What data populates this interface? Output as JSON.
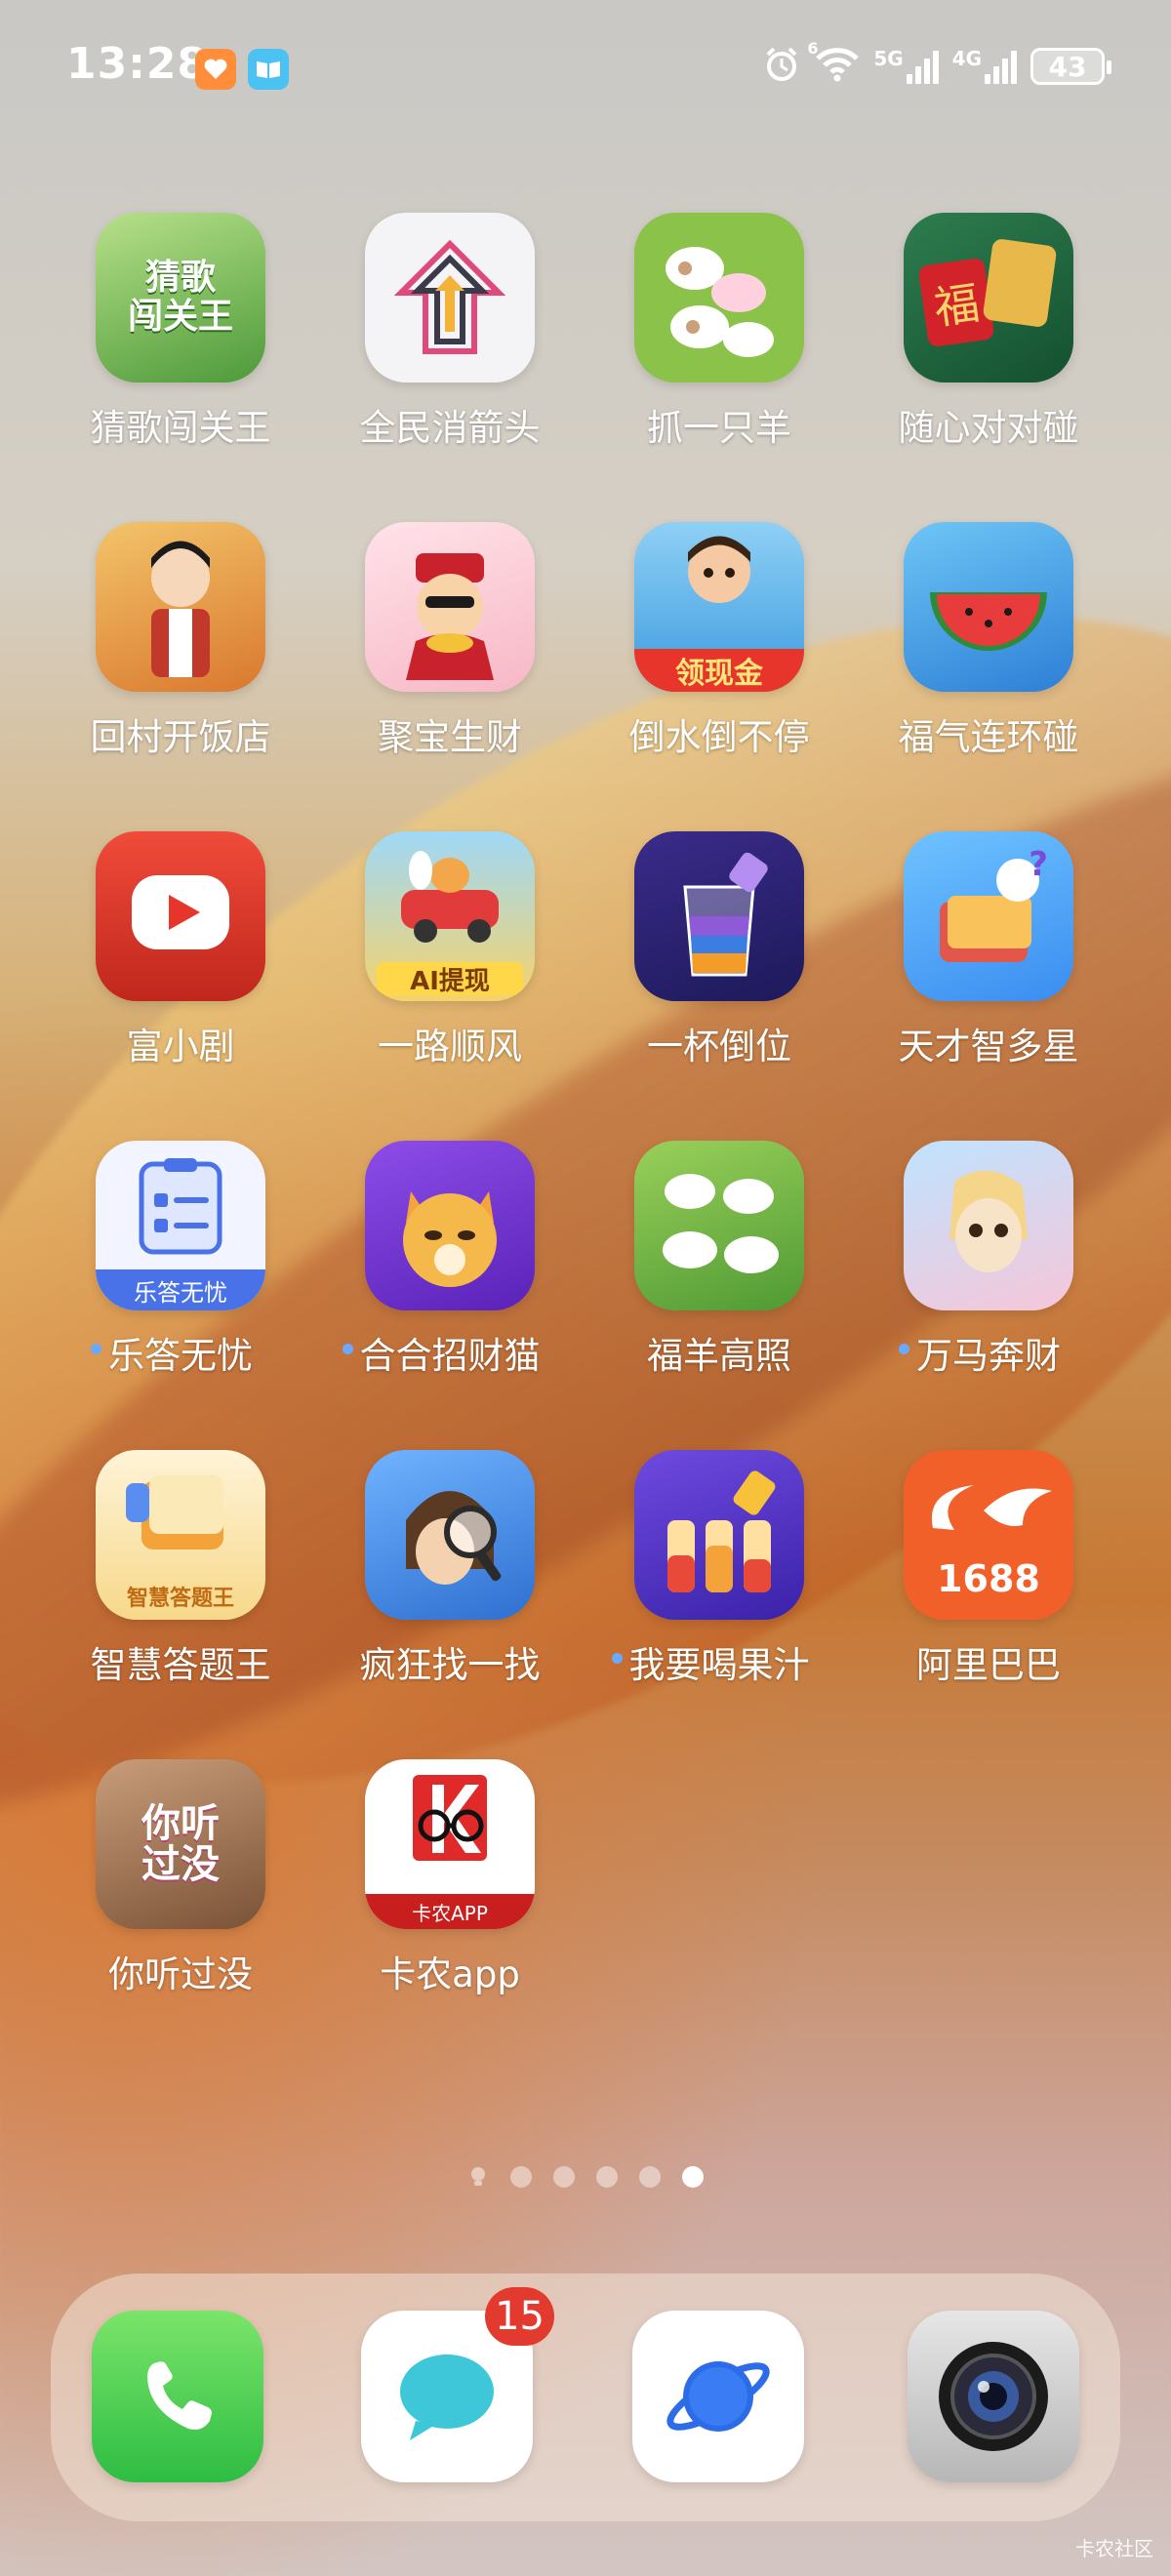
{
  "status_bar": {
    "time": "13:28",
    "network1": "5G",
    "network2": "4G",
    "wifi_sub": "6",
    "battery": "43",
    "status_icons": [
      "heart-app-icon",
      "book-app-icon",
      "alarm-icon",
      "wifi-icon",
      "signal-icon"
    ]
  },
  "apps": [
    {
      "label": "猜歌闯关王",
      "icon_text": "猜歌\n闯关王",
      "has_dot": false
    },
    {
      "label": "全民消箭头",
      "icon_text": "",
      "has_dot": false
    },
    {
      "label": "抓一只羊",
      "icon_text": "",
      "has_dot": false
    },
    {
      "label": "随心对对碰",
      "icon_text": "福",
      "has_dot": false
    },
    {
      "label": "回村开饭店",
      "icon_text": "",
      "has_dot": false
    },
    {
      "label": "聚宝生财",
      "icon_text": "",
      "has_dot": false
    },
    {
      "label": "倒水倒不停",
      "icon_text": "领现金",
      "has_dot": false
    },
    {
      "label": "福气连环碰",
      "icon_text": "",
      "has_dot": false
    },
    {
      "label": "富小剧",
      "icon_text": "",
      "has_dot": false
    },
    {
      "label": "一路顺风",
      "icon_text": "AI提现",
      "has_dot": false
    },
    {
      "label": "一杯倒位",
      "icon_text": "",
      "has_dot": false
    },
    {
      "label": "天才智多星",
      "icon_text": "?",
      "has_dot": false
    },
    {
      "label": "乐答无忧",
      "icon_text": "乐答无忧",
      "has_dot": true
    },
    {
      "label": "合合招财猫",
      "icon_text": "",
      "has_dot": true
    },
    {
      "label": "福羊高照",
      "icon_text": "",
      "has_dot": false
    },
    {
      "label": "万马奔财",
      "icon_text": "",
      "has_dot": true
    },
    {
      "label": "智慧答题王",
      "icon_text": "智慧答题王",
      "has_dot": false
    },
    {
      "label": "疯狂找一找",
      "icon_text": "",
      "has_dot": false
    },
    {
      "label": "我要喝果汁",
      "icon_text": "",
      "has_dot": true
    },
    {
      "label": "阿里巴巴",
      "icon_text": "1688",
      "has_dot": false
    },
    {
      "label": "你听过没",
      "icon_text": "你听\n过没",
      "has_dot": false
    },
    {
      "label": "卡农app",
      "icon_text": "卡农APP",
      "has_dot": false
    }
  ],
  "page_indicator": {
    "count": 5,
    "active": 5
  },
  "dock": [
    {
      "name": "phone",
      "badge": ""
    },
    {
      "name": "messages",
      "badge": "15"
    },
    {
      "name": "browser",
      "badge": ""
    },
    {
      "name": "camera",
      "badge": ""
    }
  ],
  "watermark": "卡农社区",
  "colors": {
    "accent_dot": "#6aa9ff",
    "badge": "#e23a2f"
  }
}
